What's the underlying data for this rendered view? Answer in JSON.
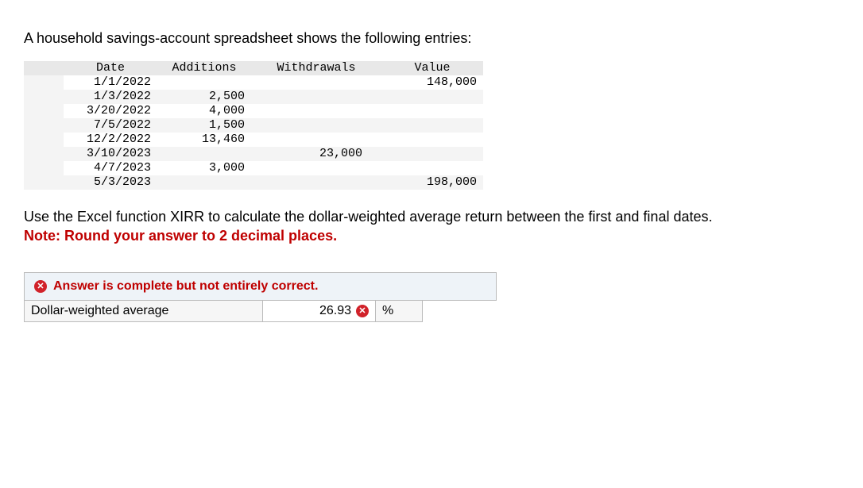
{
  "intro": "A household savings-account spreadsheet shows the following entries:",
  "ledger": {
    "headers": {
      "date": "Date",
      "additions": "Additions",
      "withdrawals": "Withdrawals",
      "value": "Value"
    },
    "rows": [
      {
        "date": "1/1/2022",
        "additions": "",
        "withdrawals": "",
        "value": "148,000"
      },
      {
        "date": "1/3/2022",
        "additions": "2,500",
        "withdrawals": "",
        "value": ""
      },
      {
        "date": "3/20/2022",
        "additions": "4,000",
        "withdrawals": "",
        "value": ""
      },
      {
        "date": "7/5/2022",
        "additions": "1,500",
        "withdrawals": "",
        "value": ""
      },
      {
        "date": "12/2/2022",
        "additions": "13,460",
        "withdrawals": "",
        "value": ""
      },
      {
        "date": "3/10/2023",
        "additions": "",
        "withdrawals": "23,000",
        "value": ""
      },
      {
        "date": "4/7/2023",
        "additions": "3,000",
        "withdrawals": "",
        "value": ""
      },
      {
        "date": "5/3/2023",
        "additions": "",
        "withdrawals": "",
        "value": "198,000"
      }
    ]
  },
  "instruction": "Use the Excel function XIRR to calculate the dollar-weighted average return between the first and final dates.",
  "note": "Note: Round your answer to 2 decimal places.",
  "answer": {
    "banner": "Answer is complete but not entirely correct.",
    "label": "Dollar-weighted average",
    "value": "26.93",
    "unit": "%"
  }
}
